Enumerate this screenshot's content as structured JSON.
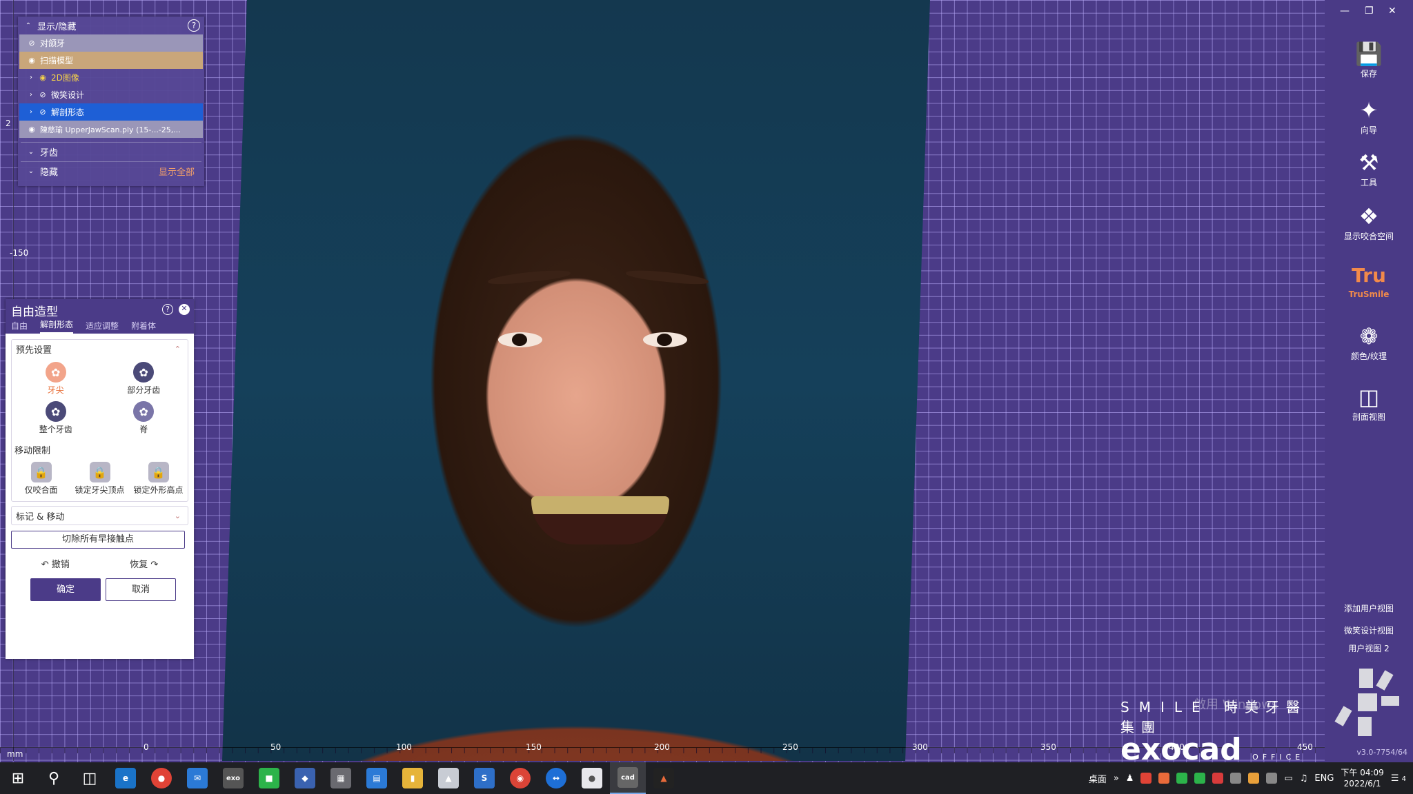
{
  "show_hide": {
    "title": "显示/隐藏",
    "help": "?",
    "items": [
      {
        "label": "对颌牙"
      },
      {
        "label": "扫描模型"
      },
      {
        "label": "2D图像"
      },
      {
        "label": "微笑设计"
      },
      {
        "label": "解剖形态"
      },
      {
        "label": "陳慈瑜 UpperJawScan.ply (15-...-25,..."
      }
    ],
    "teeth_section": "牙齿",
    "hidden_section": "隐藏",
    "show_all": "显示全部"
  },
  "freeform": {
    "title": "自由造型",
    "tabs": [
      "自由",
      "解剖形态",
      "适应调整",
      "附着体"
    ],
    "presets": {
      "heading": "预先设置",
      "tools": [
        "牙尖",
        "部分牙齿",
        "整个牙齿",
        "脊"
      ]
    },
    "movement": {
      "heading": "移动限制",
      "tools": [
        "仅咬合面",
        "锁定牙尖顶点",
        "锁定外形高点"
      ]
    },
    "mark_move": "标记 & 移动",
    "remove_contacts": "切除所有早接触点",
    "undo": "撤销",
    "redo": "恢复",
    "ok": "确定",
    "cancel": "取消"
  },
  "rightbar": {
    "save": "保存",
    "wizard": "向导",
    "tools": "工具",
    "occlusal_space": "显示咬合空间",
    "trusmile_logo": "Tru",
    "trusmile": "TruSmile",
    "color_texture": "颜色/纹理",
    "section_view": "剖面视图",
    "add_user_view": "添加用户视图",
    "smile_design_view": "微笑设计视图",
    "user_view_2": "用户视图 2",
    "version": "v3.0-7754/64"
  },
  "ruler": {
    "unit": "mm",
    "left_label_150": "-150",
    "left_label_2": "2",
    "ticks": [
      "0",
      "50",
      "100",
      "150",
      "200",
      "250",
      "300",
      "350",
      "400",
      "450"
    ]
  },
  "watermark": {
    "smile": "SMILE",
    "chinese": "時美牙醫集團",
    "exocad": "exocad",
    "office": "OFFICE",
    "activate": "啟用 Windows"
  },
  "taskbar": {
    "desktop": "桌面",
    "lang": "ENG",
    "time": "下午 04:09",
    "date": "2022/6/1",
    "notifications": "4"
  },
  "colors": {
    "viewport": "#4b3b88",
    "accent_orange": "#e8703a",
    "row_selected_blue": "#1e5fd6",
    "row_tan": "#c9a67a"
  }
}
